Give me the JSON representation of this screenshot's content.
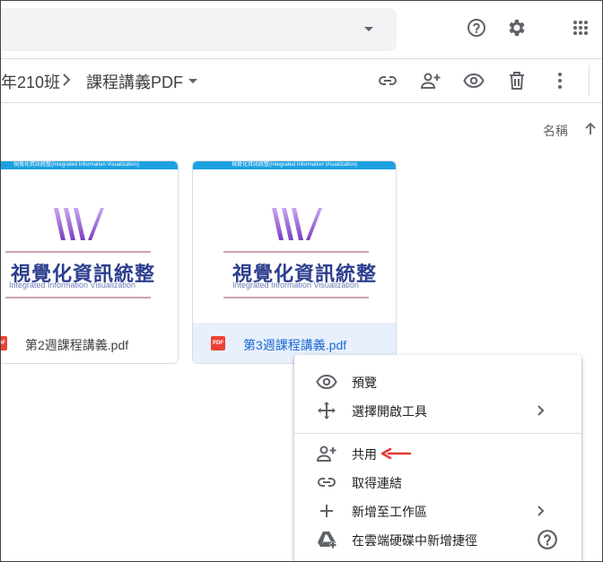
{
  "header": {
    "search_dropdown_icon": "caret-down-icon",
    "help_icon": "help-icon",
    "settings_icon": "gear-icon",
    "apps_icon": "apps-grid-icon"
  },
  "breadcrumb": {
    "parent": "年210班",
    "current": "課程講義PDF",
    "separator_icon": "chevron-right-icon",
    "dropdown_icon": "caret-down-icon"
  },
  "toolbar": {
    "link_icon": "link-icon",
    "share_icon": "person-add-icon",
    "preview_icon": "eye-icon",
    "delete_icon": "trash-icon",
    "more_icon": "more-vert-icon"
  },
  "sort": {
    "label": "名稱",
    "direction_icon": "arrow-up-icon"
  },
  "files": [
    {
      "name": "第2週課程講義.pdf",
      "file_badge": "PDF",
      "thumb_band": "視覺化資訊統整(Integrated Information Visualization)",
      "thumb_title": "視覺化資訊統整",
      "thumb_subtitle": "Integrated Information Visualization",
      "selected": false
    },
    {
      "name": "第3週課程講義.pdf",
      "file_badge": "PDF",
      "thumb_band": "視覺化資訊統整(Integrated Information Visualization)",
      "thumb_title": "視覺化資訊統整",
      "thumb_subtitle": "Integrated Information Visualization",
      "selected": true
    }
  ],
  "context_menu": {
    "items": [
      {
        "label": "預覽",
        "icon": "eye-icon"
      },
      {
        "label": "選擇開啟工具",
        "icon": "open-with-icon",
        "has_submenu": true
      },
      {
        "label": "共用",
        "icon": "person-add-icon",
        "annotated": true
      },
      {
        "label": "取得連結",
        "icon": "link-icon"
      },
      {
        "label": "新增至工作區",
        "icon": "plus-icon",
        "has_submenu": true
      },
      {
        "label": "在雲端硬碟中新增捷徑",
        "icon": "drive-shortcut-icon",
        "help": true
      }
    ]
  },
  "colors": {
    "accent_blue": "#1967d2",
    "selected_bg": "#e8f0fe",
    "pdf_red": "#ea4335",
    "annotation_red": "#e53935",
    "thumb_band": "#1ba1e2",
    "thumb_title": "#2c3e8f"
  }
}
